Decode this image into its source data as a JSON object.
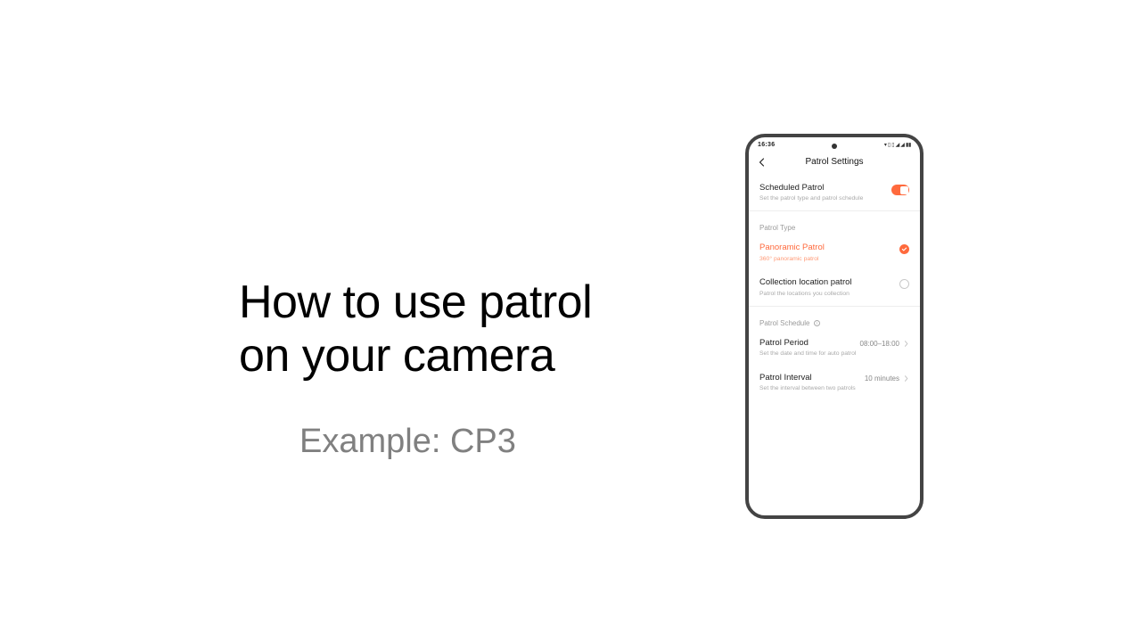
{
  "slide": {
    "title_line1": "How to use patrol",
    "title_line2": "on your camera",
    "subtitle": "Example: CP3"
  },
  "phone": {
    "status_time": "16:36",
    "nav_title": "Patrol Settings",
    "scheduled": {
      "title": "Scheduled Patrol",
      "sub": "Set the patrol type and patrol schedule",
      "toggle_on": true
    },
    "section_type_header": "Patrol Type",
    "type_panoramic": {
      "title": "Panoramic Patrol",
      "sub": "360° panoramic patrol",
      "selected": true
    },
    "type_collection": {
      "title": "Collection location patrol",
      "sub": "Patrol the locations you collection",
      "selected": false
    },
    "section_schedule_header": "Patrol Schedule",
    "period": {
      "title": "Patrol Period",
      "sub": "Set the date and time for auto patrol",
      "value": "08:00–18:00"
    },
    "interval": {
      "title": "Patrol Interval",
      "sub": "Set the interval between two patrols",
      "value": "10 minutes"
    }
  }
}
